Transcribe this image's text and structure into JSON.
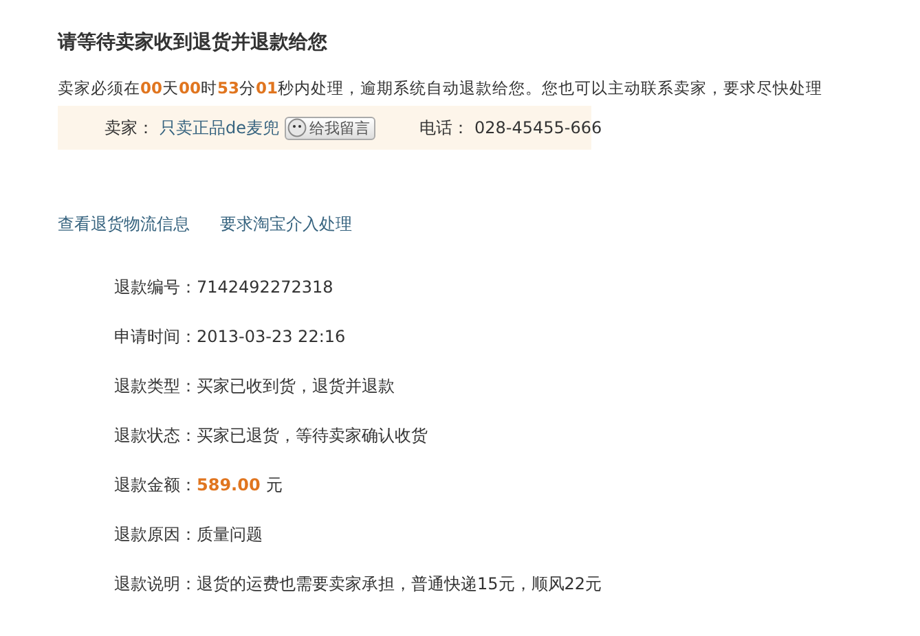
{
  "title": "请等待卖家收到退货并退款给您",
  "notice": "卖家必须在**00**天**00**时**53**分**01**秒内处理，逾期系统自动退款给您。您也可以主动联系卖家，要求尽快处理",
  "seller": {
    "label": "卖家：",
    "name": "只卖正品de麦兜",
    "message_button": "给我留言",
    "phone_label": "电话：",
    "phone": "028-45455-666"
  },
  "links": [
    "查看退货物流信息",
    "要求淘宝介入处理"
  ],
  "details": [
    {
      "label": "退款编号：",
      "value": "7142492272318"
    },
    {
      "label": "申请时间：",
      "value": "2013-03-23 22:16"
    },
    {
      "label": "退款类型：",
      "value": "买家已收到货，退货并退款"
    },
    {
      "label": "退款状态：",
      "value": "买家已退货，等待卖家确认收货"
    },
    {
      "label": "退款金额：",
      "value": "589.00",
      "unit": "元",
      "kind": "amount"
    },
    {
      "label": "退款原因：",
      "value": "质量问题"
    },
    {
      "label": "退款说明：",
      "value": "退货的运费也需要卖家承担，普通快递15元，顺风22元"
    }
  ]
}
